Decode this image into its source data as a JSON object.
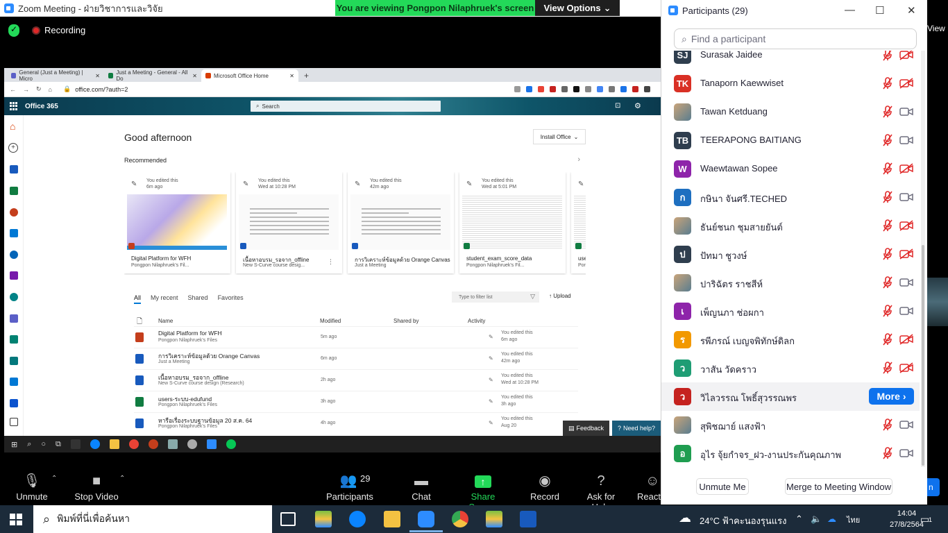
{
  "zoom": {
    "window_title": "Zoom Meeting - ฝ่ายวิชาการและวิจัย",
    "viewing_banner": "You are viewing Pongpon Nilaphruek's screen",
    "view_options": "View Options",
    "recording": "Recording"
  },
  "browser": {
    "tabs": [
      {
        "label": "General (Just a Meeting) | Micro",
        "color": "#5b5fc7",
        "active": false
      },
      {
        "label": "Just a Meeting - General - All Do",
        "color": "#107c41",
        "active": false
      },
      {
        "label": "Microsoft Office Home",
        "color": "#d83b01",
        "active": true
      }
    ],
    "url": "office.com/?auth=2",
    "app_name": "Office 365",
    "search_placeholder": "Search"
  },
  "office": {
    "greeting": "Good afternoon",
    "install_office": "Install Office",
    "recommended": "Recommended",
    "cards": [
      {
        "meta1": "You edited this",
        "meta2": "6m ago",
        "title": "Digital Platform for WFH",
        "sub": "Pongpon Nilaphruek's Fil...",
        "badge": "#c43e1c"
      },
      {
        "meta1": "You edited this",
        "meta2": "Wed at 10:28 PM",
        "title": "เนื้อหาอบรม_รอจาก_offline",
        "sub": "New S-Curve course desig...",
        "badge": "#185abd"
      },
      {
        "meta1": "You edited this",
        "meta2": "42m ago",
        "title": "การวิเคราะห์ข้อมูลด้วย Orange Canvas",
        "sub": "Just a Meeting",
        "badge": "#185abd"
      },
      {
        "meta1": "You edited this",
        "meta2": "Wed at 5:01 PM",
        "title": "student_exam_score_data",
        "sub": "Pongpon Nilaphruek's Fil...",
        "badge": "#107c41"
      },
      {
        "meta1": "",
        "meta2": "",
        "title": "use",
        "sub": "Por",
        "badge": "#107c41"
      }
    ],
    "list_tabs": [
      "All",
      "My recent",
      "Shared",
      "Favorites"
    ],
    "filter_placeholder": "Type to filter list",
    "upload": "Upload",
    "columns": {
      "name": "Name",
      "modified": "Modified",
      "shared_by": "Shared by",
      "activity": "Activity"
    },
    "files": [
      {
        "name": "Digital Platform for WFH",
        "location": "Pongpon Nilaphruek's Files",
        "modified": "5m ago",
        "act1": "You edited this",
        "act2": "6m ago",
        "color": "#c43e1c"
      },
      {
        "name": "การวิเคราะห์ข้อมูลด้วย Orange Canvas",
        "location": "Just a Meeting",
        "modified": "6m ago",
        "act1": "You edited this",
        "act2": "42m ago",
        "color": "#185abd"
      },
      {
        "name": "เนื้อหาอบรม_รอจาก_offline",
        "location": "New S-Curve course design (Research)",
        "modified": "2h ago",
        "act1": "You edited this",
        "act2": "Wed at 10:28 PM",
        "color": "#185abd"
      },
      {
        "name": "users-ระบบ-edufund",
        "location": "Pongpon Nilaphruek's Files",
        "modified": "3h ago",
        "act1": "You edited this",
        "act2": "3h ago",
        "color": "#107c41"
      },
      {
        "name": "หารือเรื่องระบบฐานข้อมูล 20 ส.ค. 64",
        "location": "Pongpon Nilaphruek's Files",
        "modified": "4h ago",
        "act1": "You edited this",
        "act2": "Aug 20",
        "color": "#185abd"
      }
    ],
    "feedback": "Feedback",
    "need_help": "Need help?"
  },
  "toolbar": {
    "unmute": "Unmute",
    "stop_video": "Stop Video",
    "participants": "Participants",
    "participants_count": "29",
    "chat": "Chat",
    "share_screen": "Share Screen",
    "record": "Record",
    "ask_for_help": "Ask for Help",
    "reactions": "Reacti"
  },
  "participants_panel": {
    "title": "Participants (29)",
    "search_placeholder": "Find a participant",
    "more_label": "More",
    "unmute_me": "Unmute Me",
    "merge": "Merge to Meeting Window",
    "people": [
      {
        "initials": "SJ",
        "name": "Surasak Jaidee",
        "color": "#2f3e4e",
        "cam_off": true
      },
      {
        "initials": "TK",
        "name": "Tanaporn Kaewwiset",
        "color": "#d93025",
        "cam_off": true
      },
      {
        "initials": "",
        "name": "Tawan Ketduang",
        "color": "",
        "cam_off": false
      },
      {
        "initials": "TB",
        "name": "TEERAPONG  BAITIANG",
        "color": "#2f3e4e",
        "cam_off": false
      },
      {
        "initials": "W",
        "name": "Waewtawan Sopee",
        "color": "#8e24aa",
        "cam_off": true
      },
      {
        "initials": "ก",
        "name": "กษินา  จันศรี.TECHED",
        "color": "#1e6fc0",
        "cam_off": false
      },
      {
        "initials": "",
        "name": "ธันย์ชนก ชุมสายยันต์",
        "color": "",
        "cam_off": true
      },
      {
        "initials": "ป",
        "name": "ปัทมา  ชูวงษ์",
        "color": "#2f3e4e",
        "cam_off": true
      },
      {
        "initials": "",
        "name": "ปาริฉัตร  ราชสีห์",
        "color": "",
        "cam_off": false
      },
      {
        "initials": "เ",
        "name": "เพ็ญนภา ช่อผกา",
        "color": "#8e24aa",
        "cam_off": false
      },
      {
        "initials": "ร",
        "name": "รพีภรณ์ เบญจพิทักษ์ดิลก",
        "color": "#f29900",
        "cam_off": true
      },
      {
        "initials": "ว",
        "name": "วาสัน วัดคราว",
        "color": "#1f9d74",
        "cam_off": true
      },
      {
        "initials": "ว",
        "name": "วิไลวรรณ โพธิ์สุวรรณพร",
        "color": "#c5221f",
        "cam_off": false,
        "more": true
      },
      {
        "initials": "",
        "name": "สุพิชฌาย์ แสงฟ้า",
        "color": "",
        "cam_off": false
      },
      {
        "initials": "อ",
        "name": "อุไร จุ้ยกำจร_ฝว-งานประกันคุณภาพ",
        "color": "#1f9d50",
        "cam_off": false
      }
    ]
  },
  "right_strip": {
    "view": "View",
    "btn": "n"
  },
  "windows": {
    "search_placeholder": "พิมพ์ที่นี่เพื่อค้นหา",
    "weather": "24°C  ฟ้าคะนองรุนแรง",
    "lang": "ไทย",
    "time": "14:04",
    "date": "27/8/2564",
    "notifications": "1"
  }
}
